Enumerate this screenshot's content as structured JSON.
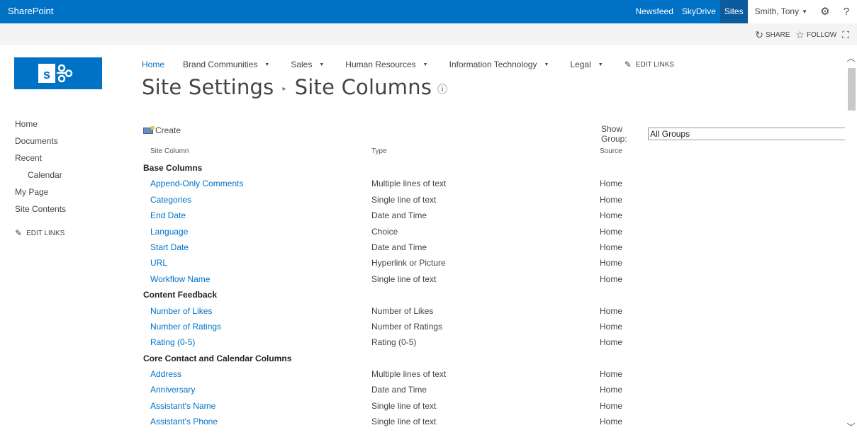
{
  "suite": {
    "brand": "SharePoint",
    "links": [
      "Newsfeed",
      "SkyDrive",
      "Sites"
    ],
    "user": "Smith, Tony",
    "settings_icon": "gear-icon",
    "help_icon": "help-icon"
  },
  "ribbon": {
    "share": "SHARE",
    "follow": "FOLLOW",
    "focus_icon": "focus-icon"
  },
  "topnav": {
    "home": "Home",
    "items": [
      "Brand Communities",
      "Sales",
      "Human Resources",
      "Information Technology",
      "Legal"
    ],
    "edit": "EDIT LINKS"
  },
  "page": {
    "breadcrumb_parent": "Site Settings",
    "title": "Site Columns"
  },
  "quicklaunch": {
    "items": [
      "Home",
      "Documents",
      "Recent",
      "Calendar",
      "My Page",
      "Site Contents"
    ],
    "edit": "EDIT LINKS"
  },
  "toolbar": {
    "create": "Create",
    "show_group_label": "Show Group:",
    "show_group_value": "All Groups"
  },
  "columns": {
    "name": "Site Column",
    "type": "Type",
    "source": "Source"
  },
  "groups": [
    {
      "name": "Base Columns",
      "rows": [
        {
          "name": "Append-Only Comments",
          "type": "Multiple lines of text",
          "source": "Home"
        },
        {
          "name": "Categories",
          "type": "Single line of text",
          "source": "Home"
        },
        {
          "name": "End Date",
          "type": "Date and Time",
          "source": "Home"
        },
        {
          "name": "Language",
          "type": "Choice",
          "source": "Home"
        },
        {
          "name": "Start Date",
          "type": "Date and Time",
          "source": "Home"
        },
        {
          "name": "URL",
          "type": "Hyperlink or Picture",
          "source": "Home"
        },
        {
          "name": "Workflow Name",
          "type": "Single line of text",
          "source": "Home"
        }
      ]
    },
    {
      "name": "Content Feedback",
      "rows": [
        {
          "name": "Number of Likes",
          "type": "Number of Likes",
          "source": "Home"
        },
        {
          "name": "Number of Ratings",
          "type": "Number of Ratings",
          "source": "Home"
        },
        {
          "name": "Rating (0-5)",
          "type": "Rating (0-5)",
          "source": "Home"
        }
      ]
    },
    {
      "name": "Core Contact and Calendar Columns",
      "rows": [
        {
          "name": "Address",
          "type": "Multiple lines of text",
          "source": "Home"
        },
        {
          "name": "Anniversary",
          "type": "Date and Time",
          "source": "Home"
        },
        {
          "name": "Assistant's Name",
          "type": "Single line of text",
          "source": "Home"
        },
        {
          "name": "Assistant's Phone",
          "type": "Single line of text",
          "source": "Home"
        }
      ]
    }
  ],
  "colors": {
    "brand_blue": "#0072c6",
    "active_tab": "#0c5b9e",
    "ribbon_bg": "#f4f4f4"
  }
}
